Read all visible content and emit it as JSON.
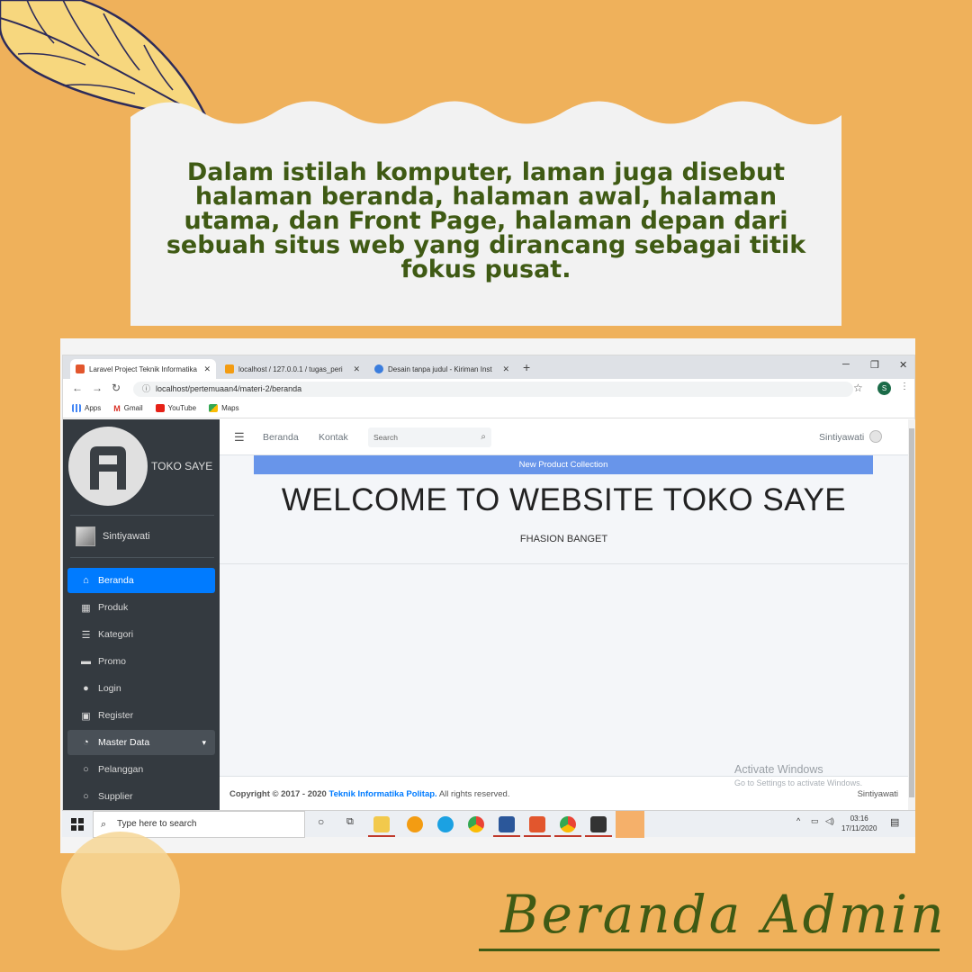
{
  "note": {
    "text": "Dalam istilah komputer, laman juga disebut halaman beranda, halaman awal, halaman utama, dan Front Page, halaman depan dari sebuah situs web yang dirancang sebagai titik fokus pusat."
  },
  "browser": {
    "tabs": [
      {
        "label": "Laravel Project Teknik Informatika",
        "active": true
      },
      {
        "label": "localhost / 127.0.0.1 / tugas_peri",
        "active": false
      },
      {
        "label": "Desain tanpa judul - Kiriman Inst",
        "active": false
      }
    ],
    "new_tab": "+",
    "url": "localhost/pertemuaan4/materi-2/beranda",
    "profile_initial": "S",
    "bookmarks": [
      "Apps",
      "Gmail",
      "YouTube",
      "Maps"
    ]
  },
  "sidebar": {
    "brand": "TOKO SAYE",
    "user": "Sintiyawati",
    "items": [
      {
        "label": "Beranda",
        "icon": "home-icon",
        "active": true
      },
      {
        "label": "Produk",
        "icon": "grid-icon"
      },
      {
        "label": "Kategori",
        "icon": "list-icon"
      },
      {
        "label": "Promo",
        "icon": "card-icon"
      },
      {
        "label": "Login",
        "icon": "user-icon"
      },
      {
        "label": "Register",
        "icon": "id-card-icon"
      },
      {
        "label": "Master Data",
        "icon": "gauge-icon",
        "group": true
      },
      {
        "label": "Pelanggan",
        "icon": "circle-icon"
      },
      {
        "label": "Supplier",
        "icon": "circle-icon"
      }
    ]
  },
  "topnav": {
    "links": [
      "Beranda",
      "Kontak"
    ],
    "search_placeholder": "Search",
    "user": "Sintiyawati"
  },
  "main": {
    "banner": "New Product Collection",
    "welcome": "WELCOME TO WEBSITE TOKO SAYE",
    "tagline": "FHASION BANGET"
  },
  "watermark": {
    "title": "Activate Windows",
    "subtitle": "Go to Settings to activate Windows."
  },
  "footer": {
    "copyright": "Copyright © 2017 - 2020",
    "org": "Teknik Informatika Politap.",
    "rights": "All rights reserved.",
    "user": "Sintiyawati"
  },
  "taskbar": {
    "search_placeholder": "Type here to search",
    "time": "03:16",
    "date": "17/11/2020"
  },
  "caption": "Beranda Admin",
  "colors": {
    "background": "#efb15b",
    "note_text": "#3f5a14",
    "sidebar": "#343a40",
    "active": "#007bff",
    "banner": "#6895ea"
  }
}
